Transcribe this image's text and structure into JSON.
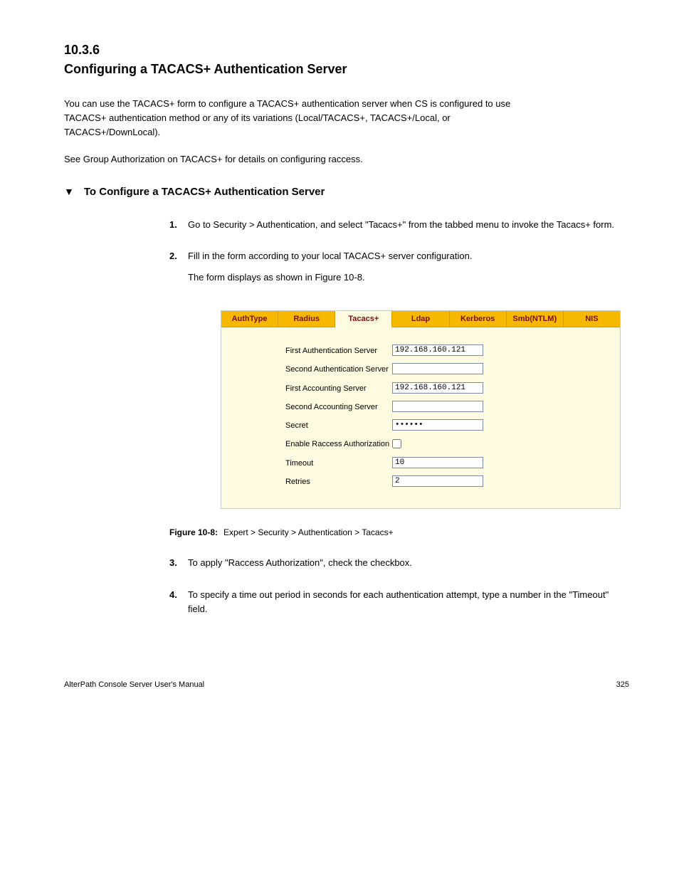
{
  "section_number": "10.3.6",
  "section_title": "Configuring a TACACS+ Authentication Server",
  "intro_para": "You can use the TACACS+ form to configure a TACACS+ authentication server when CS is configured to use TACACS+ authentication method or any of its variations (Local/TACACS+, TACACS+/Local, or TACACS+/DownLocal).",
  "xref_text": "See Group Authorization on TACACS+ for details on configuring raccess.",
  "proc_title": "To Configure a TACACS+ Authentication Server",
  "steps": {
    "1": "Go to Security > Authentication, and select \"Tacacs+\" from the tabbed menu to invoke the Tacacs+ form.",
    "2": {
      "line1": "Fill in the form according to your local TACACS+ server configuration.",
      "line2": "The form displays as shown in Figure 10-8."
    },
    "3": "To apply \"Raccess Authorization\", check the checkbox.",
    "4": "To specify a time out period in seconds for each authentication attempt, type a number in the \"Timeout\" field."
  },
  "tabs": [
    "AuthType",
    "Radius",
    "Tacacs+",
    "Ldap",
    "Kerberos",
    "Smb(NTLM)",
    "NIS"
  ],
  "active_tab_index": 2,
  "form": {
    "first_auth_label": "First Authentication Server",
    "first_auth_value": "192.168.160.121",
    "second_auth_label": "Second Authentication Server",
    "second_auth_value": "",
    "first_acct_label": "First Accounting Server",
    "first_acct_value": "192.168.160.121",
    "second_acct_label": "Second Accounting Server",
    "second_acct_value": "",
    "secret_label": "Secret",
    "secret_value": "••••••",
    "raccess_label": "Enable Raccess Authorization",
    "raccess_checked": false,
    "timeout_label": "Timeout",
    "timeout_value": "10",
    "retries_label": "Retries",
    "retries_value": "2"
  },
  "figure": {
    "num": "Figure 10-8:",
    "caption": "Expert > Security > Authentication > Tacacs+"
  },
  "footer_left": "AlterPath Console Server User's Manual",
  "footer_right": "325"
}
